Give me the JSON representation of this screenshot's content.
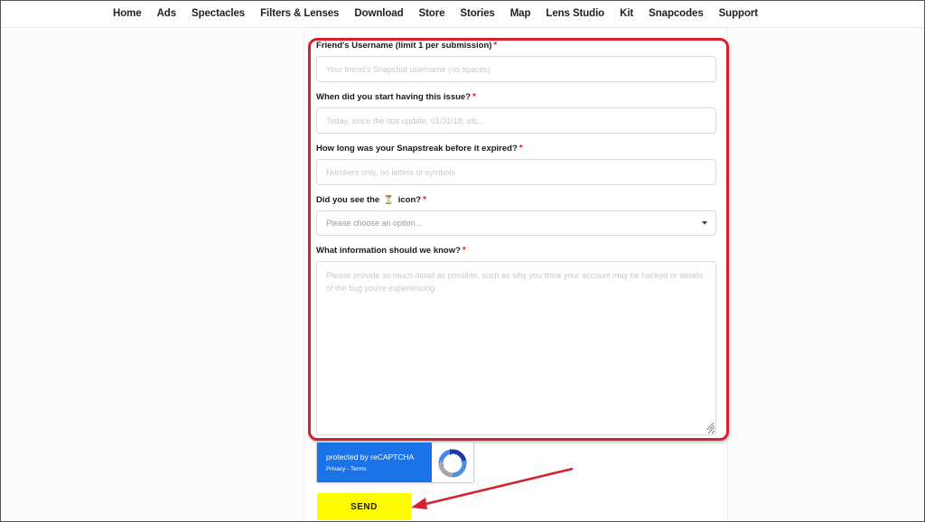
{
  "nav": {
    "items": [
      "Home",
      "Ads",
      "Spectacles",
      "Filters & Lenses",
      "Download",
      "Store",
      "Stories",
      "Map",
      "Lens Studio",
      "Kit",
      "Snapcodes",
      "Support"
    ]
  },
  "form": {
    "friend_username": {
      "label": "Friend's Username (limit 1 per submission)",
      "required_mark": "*",
      "placeholder": "Your friend's Snapchat username (no spaces)"
    },
    "issue_start": {
      "label": "When did you start having this issue?",
      "required_mark": "*",
      "placeholder": "Today, since the last update, 01/31/18, etc..."
    },
    "streak_length": {
      "label": "How long was your Snapstreak before it expired?",
      "required_mark": "*",
      "placeholder": "Numbers only, no letters or symbols"
    },
    "hourglass_seen": {
      "label_before": "Did you see the",
      "icon": "hourglass-icon",
      "icon_glyph": "⏳",
      "label_after": "icon?",
      "required_mark": "*",
      "selected": "Please choose an option..."
    },
    "info": {
      "label": "What information should we know?",
      "required_mark": "*",
      "placeholder": "Please provide as much detail as possible, such as why you think your account may be hacked or details of the bug you're experiencing"
    }
  },
  "recaptcha": {
    "title": "protected by reCAPTCHA",
    "links": "Privacy - Terms"
  },
  "send_label": "SEND",
  "colors": {
    "highlight": "#d5202e",
    "send_bg": "#fffc00",
    "recaptcha_blue": "#1a73e8",
    "required": "#e0242c"
  }
}
